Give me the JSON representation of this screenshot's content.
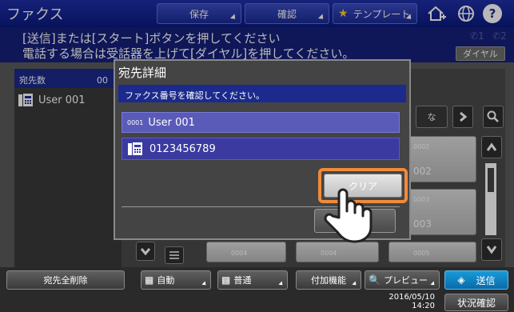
{
  "header": {
    "title": "ファクス",
    "buttons": {
      "save": "保存",
      "confirm": "確認",
      "template": "テンプレート"
    }
  },
  "message": {
    "line1": "[送信]または[スタート]ボタンを押してください",
    "line2": "電話する場合は受話器を上げて[ダイヤル]を押してください。",
    "dial": "ダイヤル",
    "line_indicators": [
      "1",
      "2"
    ]
  },
  "left_panel": {
    "header_label": "宛先数",
    "header_count": "00",
    "item": "User 001"
  },
  "grid": {
    "index_tab": "な",
    "cards": [
      {
        "num": "0002",
        "name": "002"
      },
      {
        "num": "0003",
        "name": "003"
      }
    ],
    "bottom_cards": [
      "0004",
      "0004",
      "0005"
    ]
  },
  "dialog": {
    "title": "宛先詳細",
    "message": "ファクス番号を確認してください。",
    "entry_id": "0001",
    "entry_name": "User 001",
    "fax_number": "0123456789",
    "clear": "クリア"
  },
  "bottom": {
    "delete_all": "宛先全削除",
    "auto": "自動",
    "normal": "普通",
    "extra": "付加機能",
    "preview": "プレビュー",
    "send": "送信",
    "date": "2016/05/10",
    "time": "14:20",
    "status": "状況確認"
  },
  "colors": {
    "accent": "#1b2a8c",
    "highlight": "#f08a3a",
    "send": "#1a9ad8"
  }
}
